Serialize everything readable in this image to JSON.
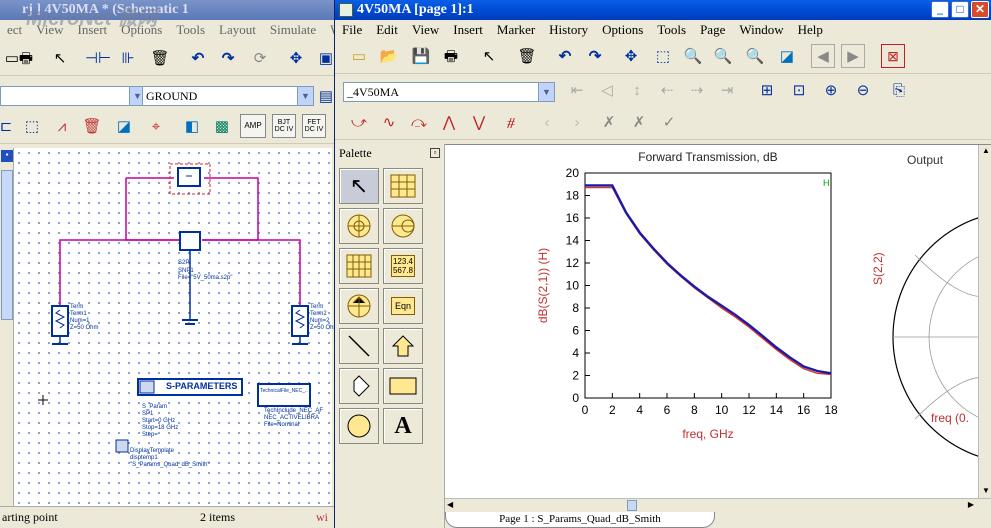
{
  "schematic": {
    "title": "rj ] 4V50MA * (Schematic 1",
    "menu": [
      "ect",
      "View",
      "Insert",
      "Options",
      "Tools",
      "Layout",
      "Simulate",
      "W"
    ],
    "component_combo": "GROUND",
    "tool_labels": {
      "amp": "AMP",
      "bjt": "BJT\nDC IV",
      "fet": "FET\nDC IV"
    },
    "canvas_labels": {
      "snp": "SNP1\nFile=\"5V_50ma.s2p\"",
      "snp_title": "S2P",
      "term1": "Term\nTerm1\nNum=1\nZ=50 Ohm",
      "term2": "Term\nTerm2\nNum=2\nZ=50 Ohm",
      "sparam_box": "S-PARAMETERS",
      "sparam_params": "S_Param\nSP1\nStart=0 GHz\nStop=18 GHz\nStep=",
      "techfile": "TechnicalFile_NEC_...",
      "tech_params": "TechInclude_NEC_AF\nNEC_ACTIVELIBRA\nFile=Nominal",
      "display_template": "DisplayTemplate\ndisptemp1\n\"S_Params_Quad_dB_Smith\""
    },
    "status": {
      "left": "arting point",
      "items": "2 items",
      "right": "wi"
    }
  },
  "watermark": "MicroNet 微网",
  "display": {
    "title": "4V50MA [page 1]:1",
    "menu": [
      "File",
      "Edit",
      "View",
      "Insert",
      "Marker",
      "History",
      "Options",
      "Tools",
      "Page",
      "Window",
      "Help"
    ],
    "dataset_combo": "_4V50MA",
    "palette_title": "Palette",
    "palette_labels": {
      "eqn": "Eqn",
      "table": "123.4\n567.8",
      "text": "A"
    },
    "status": "Page 1 : S_Params_Quad_dB_Smith",
    "colors": {
      "titlebar": "#0048d0",
      "trace_blue": "#1a1aa8",
      "trace_red": "#e03020",
      "axis_label": "#c03030",
      "wire": "#c000a0"
    }
  },
  "chart_data": [
    {
      "type": "line",
      "title": "Forward Transmission, dB",
      "xlabel": "freq, GHz",
      "ylabel": "dB(S(2,1)) (H)",
      "xlim": [
        0,
        18
      ],
      "ylim": [
        0,
        20
      ],
      "xticks": [
        0,
        2,
        4,
        6,
        8,
        10,
        12,
        14,
        16,
        18
      ],
      "yticks": [
        0,
        2,
        4,
        6,
        8,
        10,
        12,
        14,
        16,
        18,
        20
      ],
      "marker_label": "H",
      "series": [
        {
          "color": "#1a1aa8",
          "x": [
            0,
            1,
            2,
            3,
            4,
            5,
            6,
            7,
            8,
            9,
            10,
            11,
            12,
            13,
            14,
            15,
            16,
            17,
            18
          ],
          "y": [
            18.9,
            18.9,
            18.9,
            16.5,
            14.7,
            13.3,
            12.0,
            10.9,
            9.9,
            9.0,
            8.2,
            7.4,
            6.5,
            5.5,
            4.5,
            3.6,
            2.8,
            2.4,
            2.2
          ]
        },
        {
          "color": "#e03020",
          "x": [
            0,
            1,
            2,
            3,
            4,
            5,
            6,
            7,
            8,
            9,
            10,
            11,
            12,
            13,
            14,
            15,
            16,
            17,
            18
          ],
          "y": [
            18.7,
            18.7,
            18.7,
            16.4,
            14.6,
            13.2,
            11.9,
            10.8,
            9.8,
            8.9,
            8.0,
            7.2,
            6.3,
            5.3,
            4.3,
            3.4,
            2.6,
            2.2,
            2.1
          ]
        }
      ]
    },
    {
      "type": "smith",
      "title": "Output",
      "ylabel": "S(2,2)",
      "xlabel": "freq (0."
    }
  ]
}
